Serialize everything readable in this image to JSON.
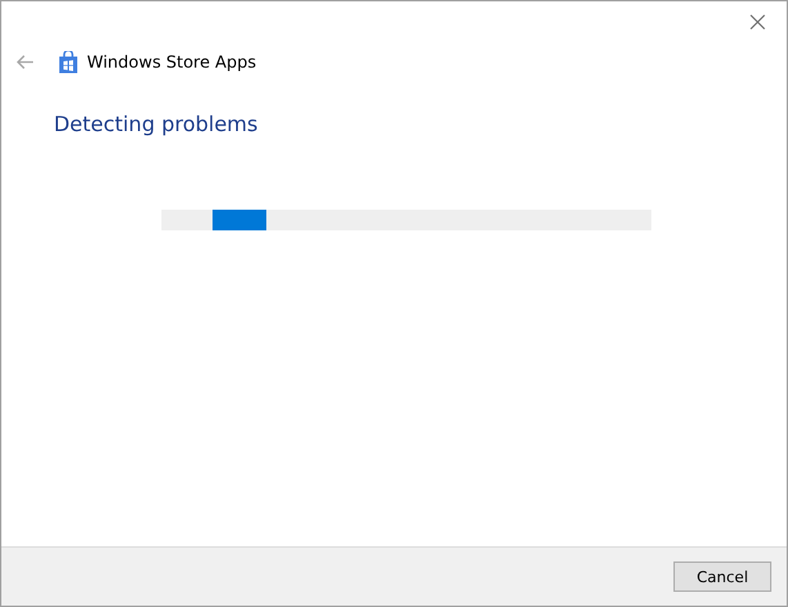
{
  "window": {
    "title": "Windows Store Apps"
  },
  "back_button": {
    "disabled": true
  },
  "heading": "Detecting problems",
  "progress": {
    "indeterminate": true
  },
  "buttons": [
    {
      "label": "Cancel"
    }
  ]
}
